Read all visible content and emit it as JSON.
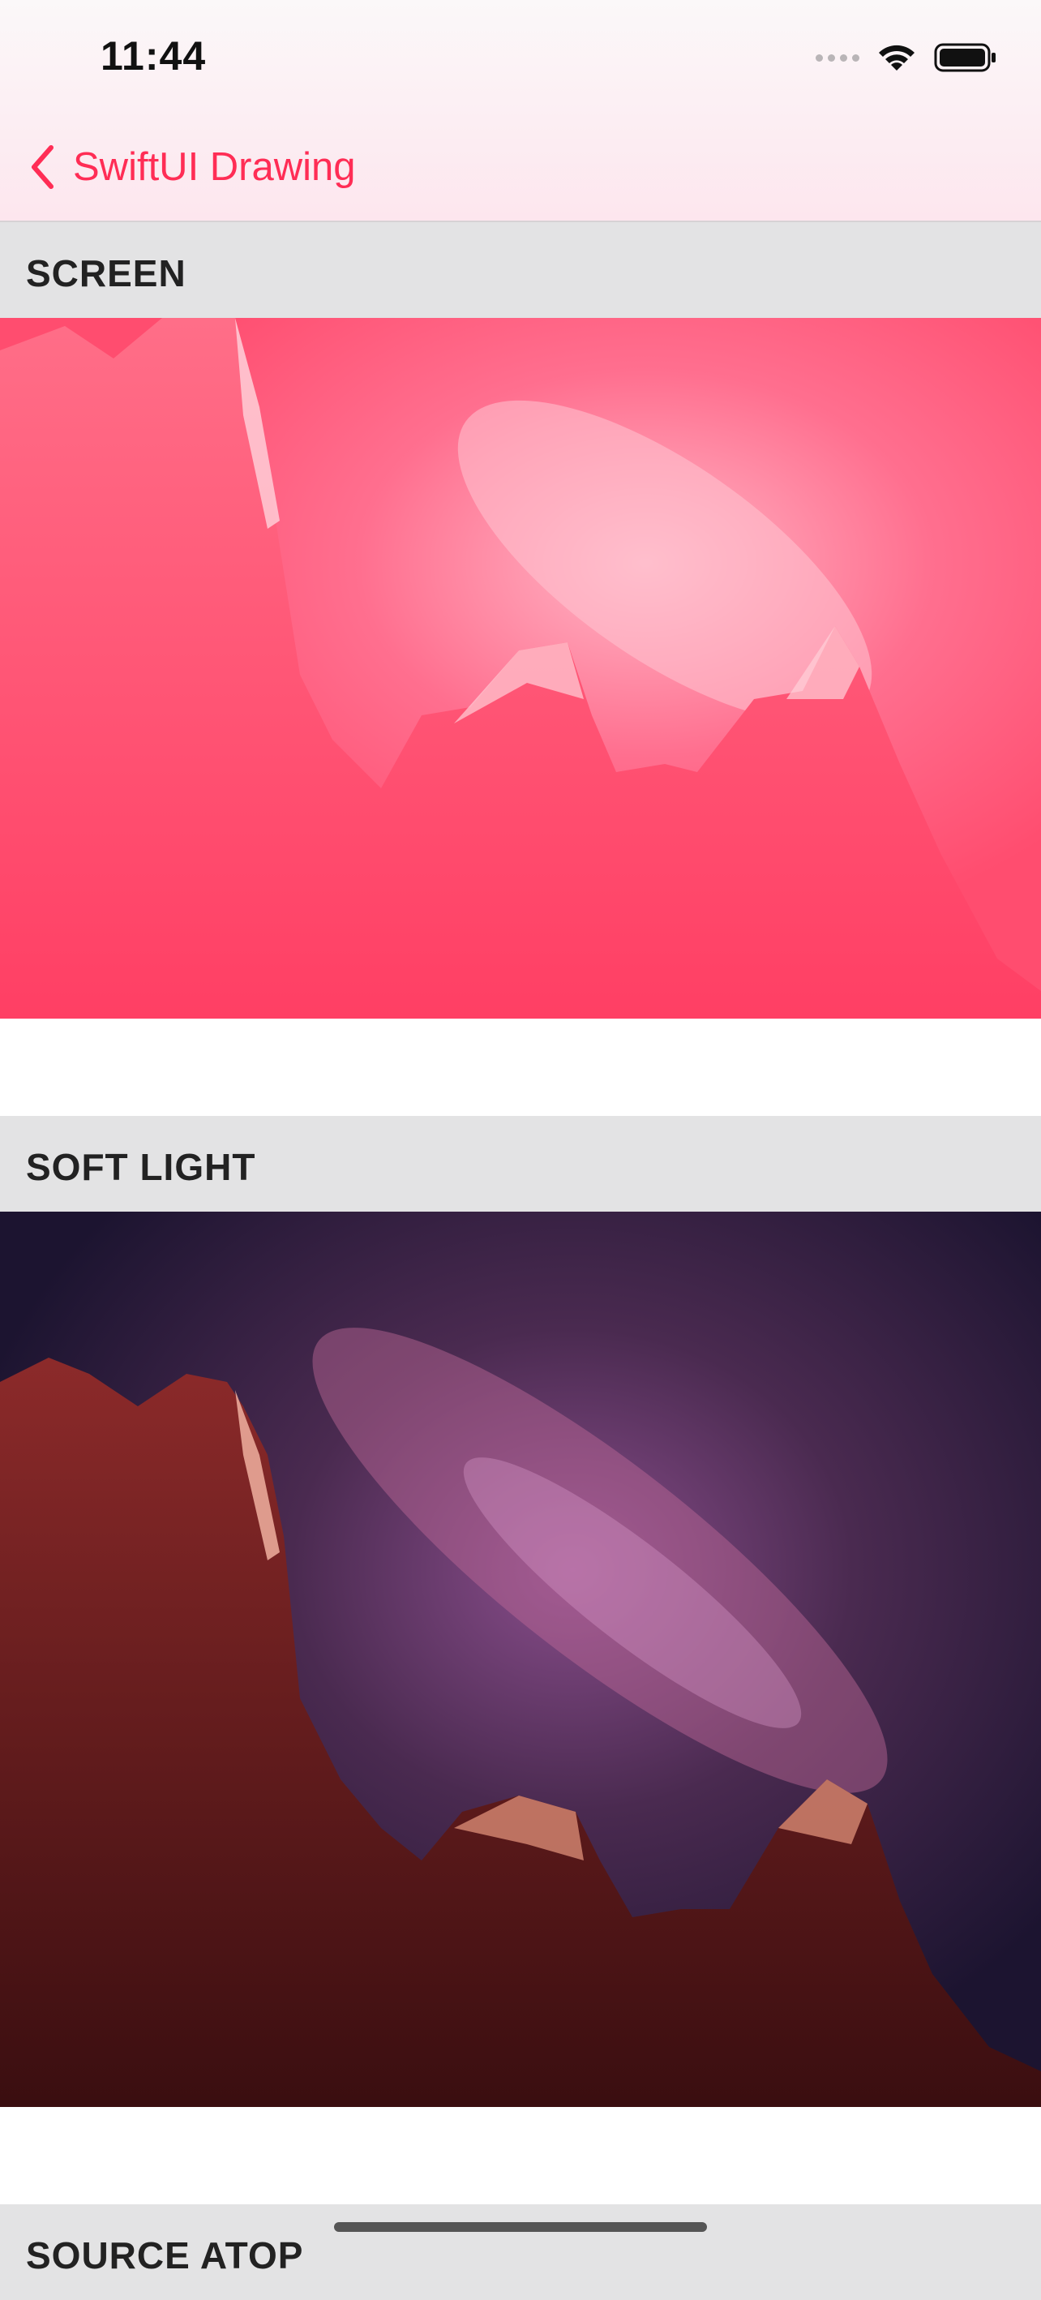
{
  "status_bar": {
    "time": "11:44",
    "icons": [
      "signal-icon",
      "wifi-icon",
      "battery-icon"
    ]
  },
  "nav": {
    "back_label": "SwiftUI Drawing",
    "accent_color": "#ff2d55"
  },
  "sections": [
    {
      "label": "SCREEN"
    },
    {
      "label": "SOFT LIGHT"
    },
    {
      "label": "SOURCE ATOP"
    }
  ]
}
